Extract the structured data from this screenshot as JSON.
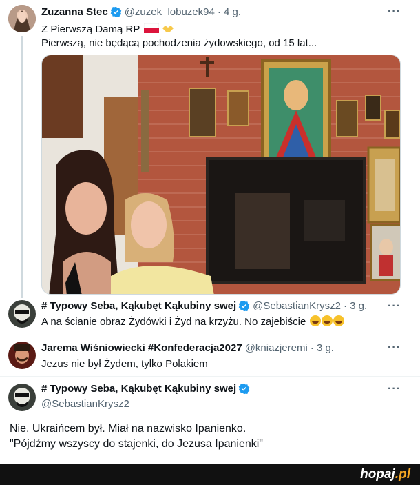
{
  "tweet1": {
    "name": "Zuzanna Stec",
    "handle": "@zuzek_lobuzek94",
    "time": "· 4 g.",
    "line1": "Z Pierwszą Damą RP",
    "line2": "Pierwszą,  nie będącą pochodzenia żydowskiego, od 15 lat..."
  },
  "tweet2": {
    "name": "# Typowy Seba, Kąkubęt Kąkubiny swej",
    "handle": "@SebastianKrysz2",
    "time": "· 3 g.",
    "text": "A na ścianie obraz Żydówki i Żyd na krzyżu. No zajebiście"
  },
  "tweet3": {
    "name": "Jarema Wiśniowiecki #Konfederacja2027",
    "handle": "@kniazjeremi",
    "time": "· 3 g.",
    "text": "Jezus nie był Żydem, tylko Polakiem"
  },
  "tweet4": {
    "name": "# Typowy Seba, Kąkubęt Kąkubiny swej",
    "handle": "@SebastianKrysz2",
    "line1": "Nie, Ukraińcem był. Miał na nazwisko Ipanienko.",
    "line2": "\"Pójdźmy wszyscy do stajenki, do Jezusa Ipanienki\""
  },
  "more_label": "···",
  "footer": {
    "logo_main": "hopaj",
    "logo_suffix": ".pl"
  },
  "colors": {
    "verified": "#1d9bf0",
    "footer": "#111111",
    "logo_accent": "#f5a623"
  }
}
